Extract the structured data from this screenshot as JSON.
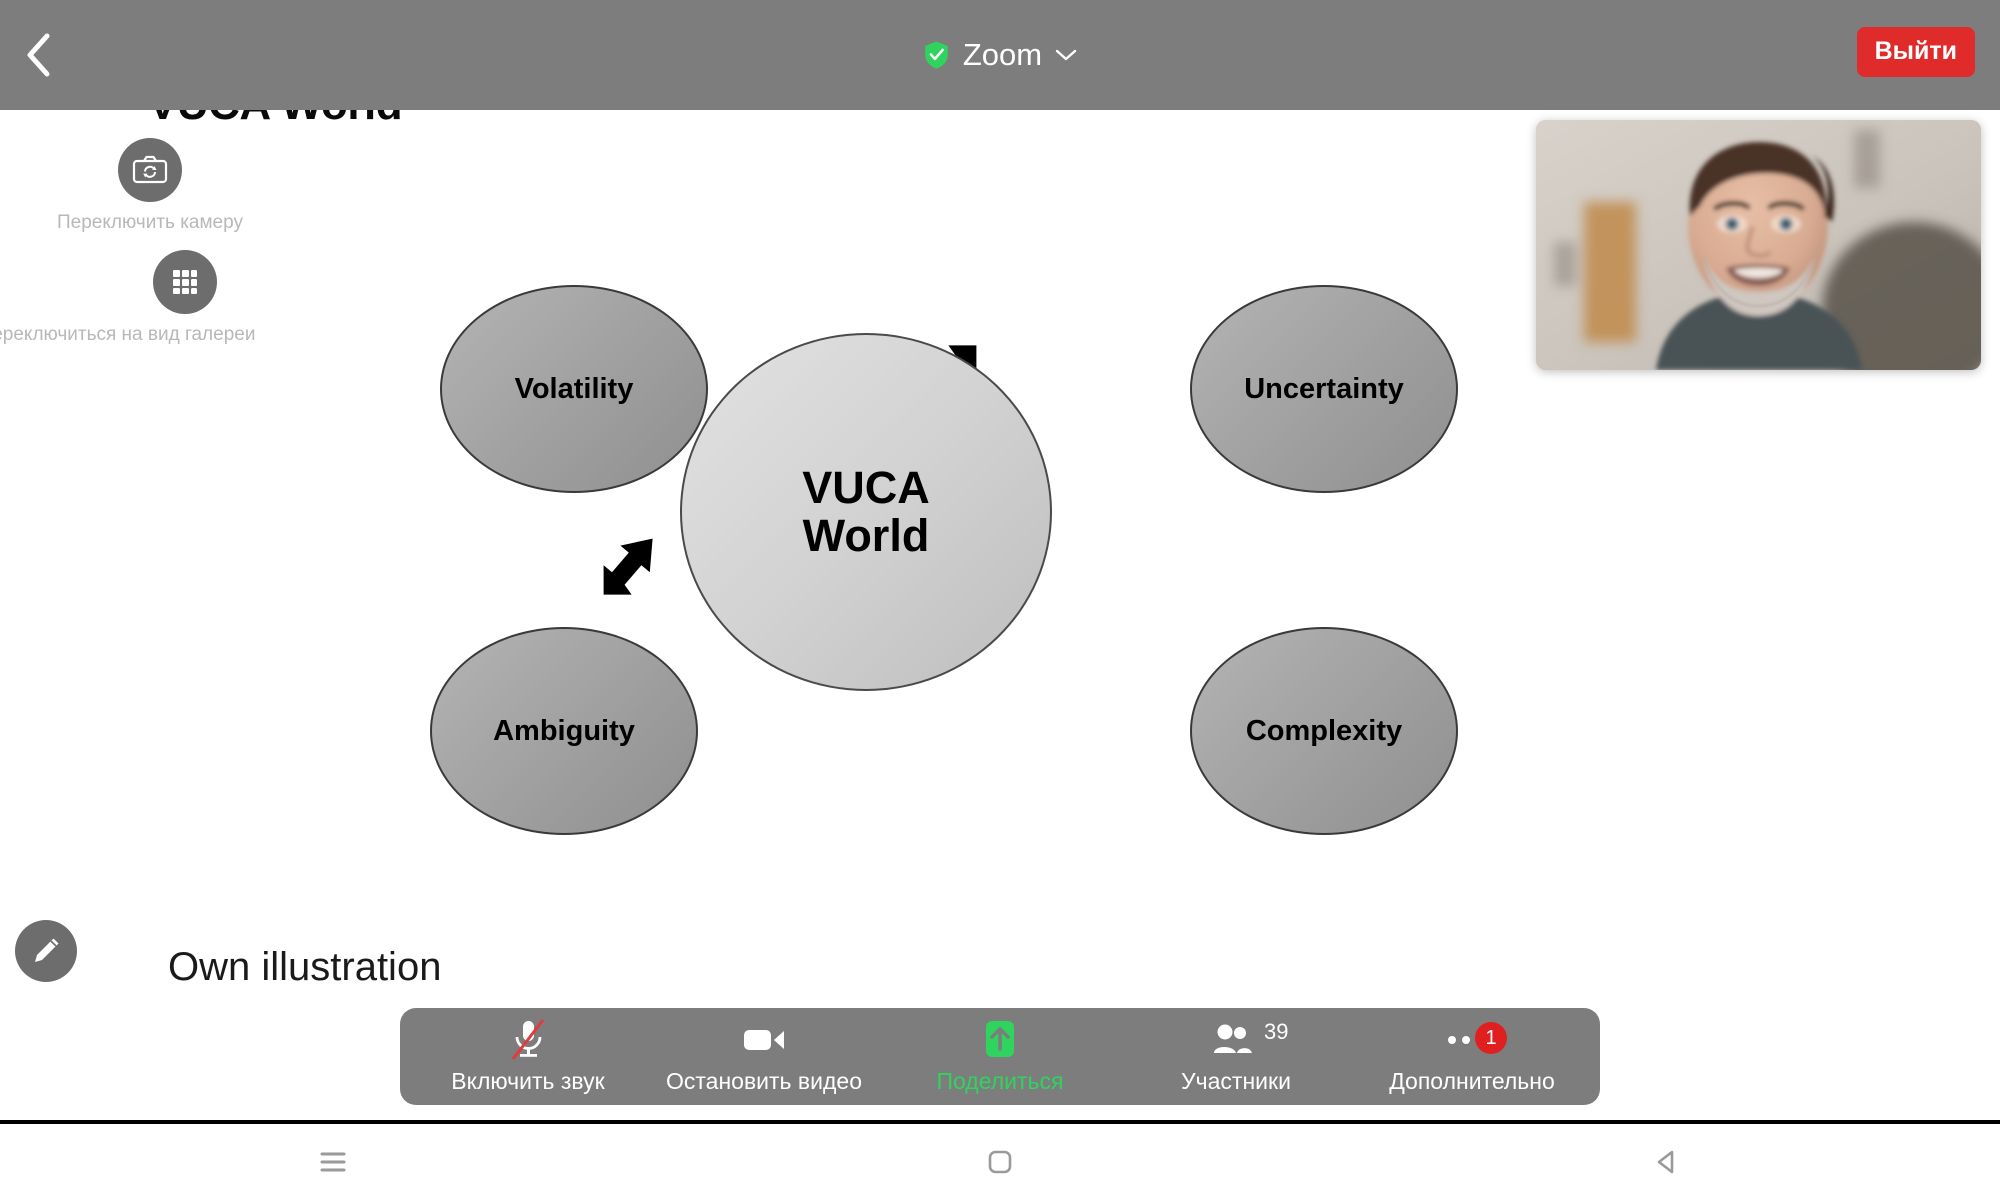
{
  "topbar": {
    "back_icon": "chevron-left-icon",
    "shield_icon": "shield-check-icon",
    "title": "Zoom",
    "chevron_icon": "chevron-down-icon",
    "leave_label": "Выйти",
    "bar_color": "#7d7d7d",
    "leave_color": "#e02b2b"
  },
  "side_controls": [
    {
      "icon": "switch-camera-icon",
      "label": "Переключить камеру"
    },
    {
      "icon": "grid-view-icon",
      "label": "Переключиться на вид галереи"
    }
  ],
  "annotate": {
    "icon": "pencil-icon"
  },
  "self_video": {
    "label": "self-view-thumbnail"
  },
  "slide": {
    "title": "VUCA World",
    "caption": "Own illustration"
  },
  "chart_data": {
    "type": "diagram",
    "title": "VUCA World",
    "center": {
      "label": "VUCA\nWorld",
      "line1": "VUCA",
      "line2": "World"
    },
    "nodes": [
      {
        "id": "volatility",
        "label": "Volatility",
        "position": "top-left"
      },
      {
        "id": "uncertainty",
        "label": "Uncertainty",
        "position": "top-right"
      },
      {
        "id": "ambiguity",
        "label": "Ambiguity",
        "position": "bottom-left"
      },
      {
        "id": "complexity",
        "label": "Complexity",
        "position": "bottom-right"
      }
    ],
    "arrows": [
      {
        "from": "center",
        "to": "volatility",
        "direction": "up-left"
      },
      {
        "from": "center",
        "to": "uncertainty",
        "direction": "up-right"
      },
      {
        "from": "center",
        "to": "ambiguity",
        "direction": "down-left"
      },
      {
        "from": "center",
        "to": "complexity",
        "direction": "down-right"
      }
    ],
    "caption": "Own illustration",
    "node_fill": "#a3a3a3",
    "center_fill": "#d2d2d2",
    "stroke": "#3a3a3a"
  },
  "toolbar": {
    "items": [
      {
        "icon": "microphone-muted-icon",
        "label": "Включить звук",
        "accent": false,
        "badge": ""
      },
      {
        "icon": "video-camera-icon",
        "label": "Остановить видео",
        "accent": false,
        "badge": ""
      },
      {
        "icon": "share-screen-icon",
        "label": "Поделиться",
        "accent": true,
        "badge": ""
      },
      {
        "icon": "participants-icon",
        "label": "Участники",
        "accent": false,
        "badge": "39"
      },
      {
        "icon": "more-dots-icon",
        "label": "Дополнительно",
        "accent": false,
        "badge": "1"
      }
    ],
    "share_color": "#2fd45f",
    "badge_color": "#e02020"
  },
  "navbar": [
    {
      "icon": "recents-menu-icon"
    },
    {
      "icon": "home-square-icon"
    },
    {
      "icon": "back-triangle-icon"
    }
  ]
}
